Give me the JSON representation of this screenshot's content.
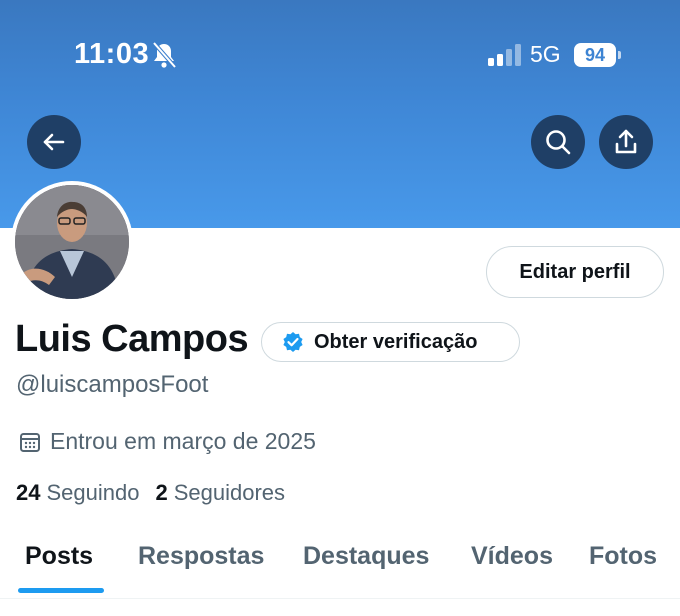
{
  "status_bar": {
    "time": "11:03",
    "network": "5G",
    "battery": "94",
    "icons": [
      "bell-slash-icon",
      "signal-icon"
    ]
  },
  "header": {
    "buttons": [
      "arrow-left-icon",
      "search-icon",
      "share-icon"
    ],
    "banner_color": "#3f87d6"
  },
  "profile": {
    "edit_button_label": "Editar perfil",
    "name": "Luis Campos",
    "verify_label": "Obter verificação",
    "handle": "@luiscamposFoot",
    "joined": "Entrou em março de 2025",
    "following_count": "24",
    "following_label": "Seguindo",
    "followers_count": "2",
    "followers_label": "Seguidores"
  },
  "tabs": [
    {
      "label": "Posts",
      "active": true
    },
    {
      "label": "Respostas",
      "active": false
    },
    {
      "label": "Destaques",
      "active": false
    },
    {
      "label": "Vídeos",
      "active": false
    },
    {
      "label": "Fotos",
      "active": false
    }
  ],
  "colors": {
    "accent": "#1d9bf0",
    "text": "#0f1419",
    "secondary": "#536471",
    "dark_button": "#1f3f66"
  }
}
